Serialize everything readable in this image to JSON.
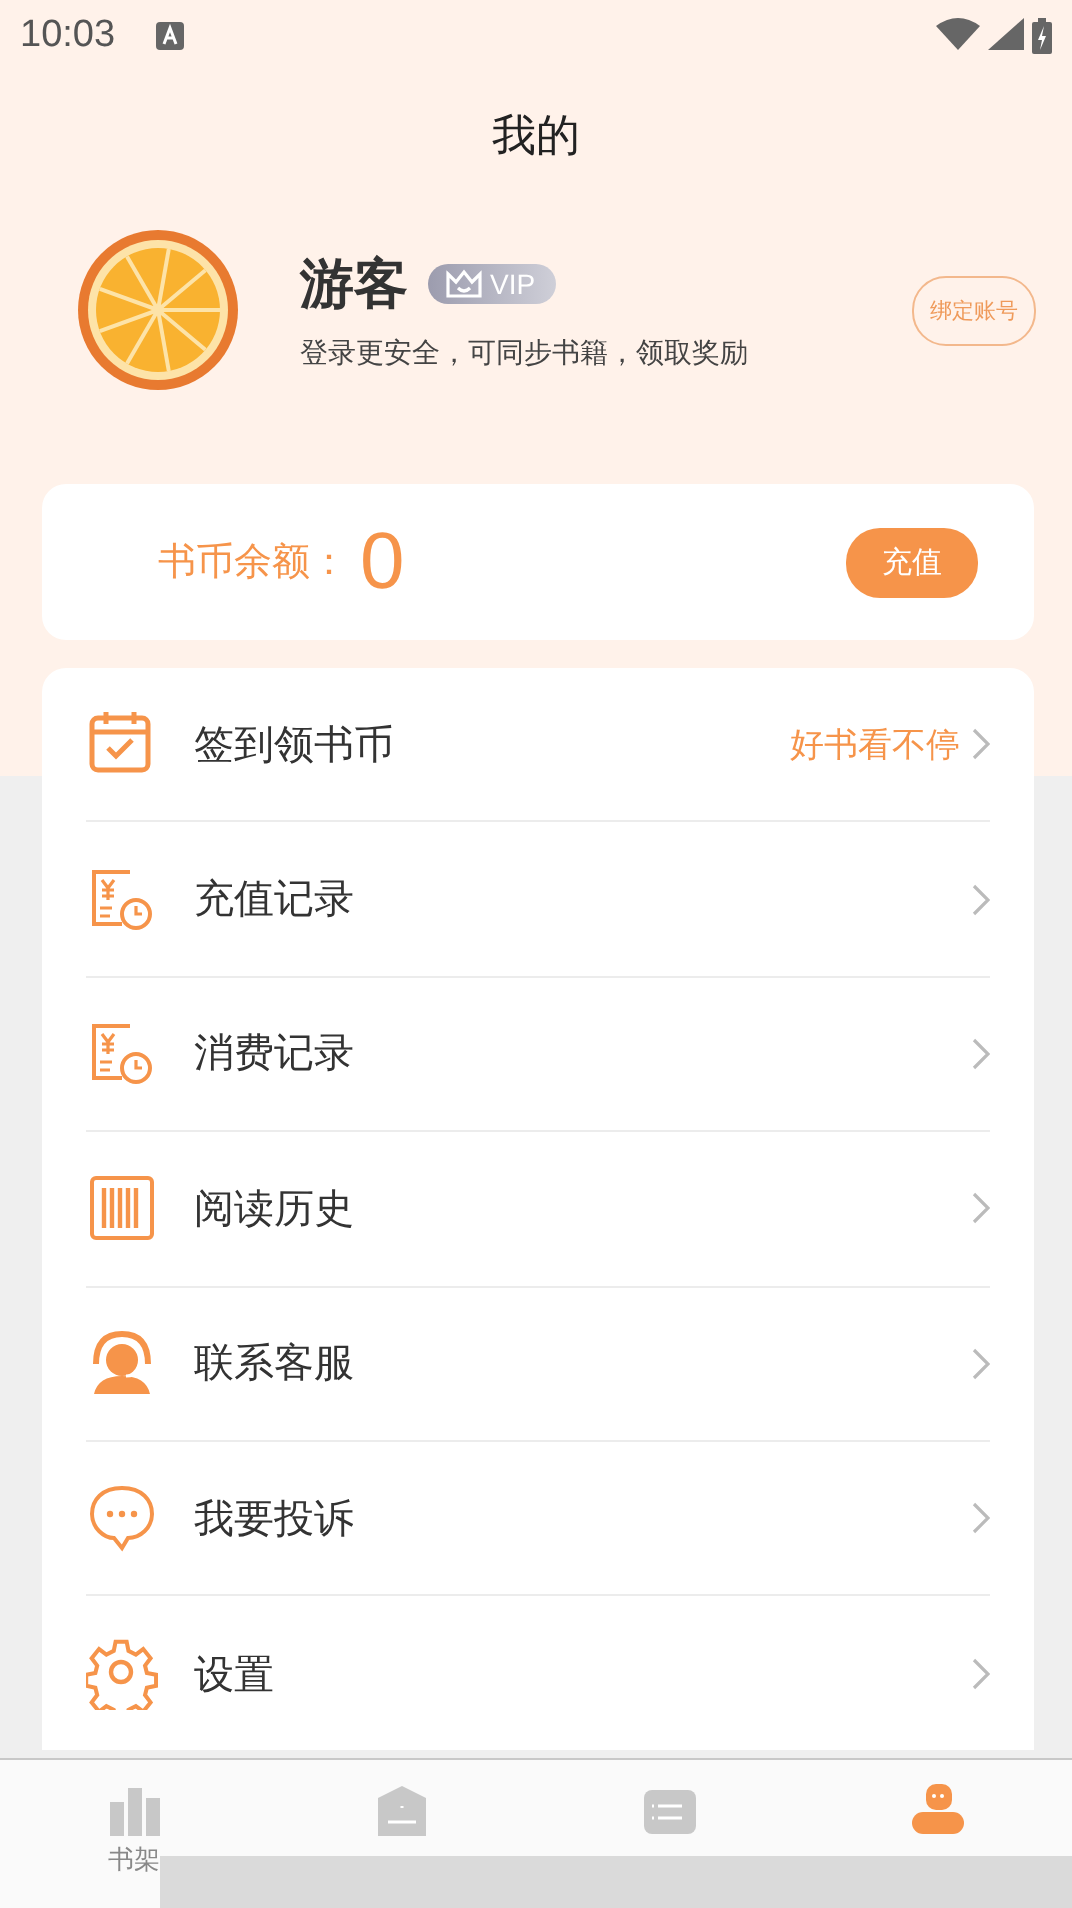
{
  "status_bar": {
    "time": "10:03"
  },
  "title": "我的",
  "profile": {
    "name": "游客",
    "badge": "VIP",
    "subtitle": "登录更安全，可同步书籍，领取奖励",
    "bind_button": "绑定账号"
  },
  "balance": {
    "label": "书币余额：",
    "value": "0",
    "button": "充值"
  },
  "menu": [
    {
      "kind": "checkin",
      "label": "签到领书币",
      "hint": "好书看不停"
    },
    {
      "kind": "receipt",
      "label": "充值记录"
    },
    {
      "kind": "receipt",
      "label": "消费记录"
    },
    {
      "kind": "history",
      "label": "阅读历史"
    },
    {
      "kind": "support",
      "label": "联系客服"
    },
    {
      "kind": "chat",
      "label": "我要投诉"
    },
    {
      "kind": "gear",
      "label": "设置"
    }
  ],
  "bottom_nav": [
    {
      "kind": "shelf",
      "label": "书架",
      "selected": false
    },
    {
      "kind": "store",
      "selected": false
    },
    {
      "kind": "list",
      "selected": false
    },
    {
      "kind": "profile",
      "selected": true
    }
  ]
}
